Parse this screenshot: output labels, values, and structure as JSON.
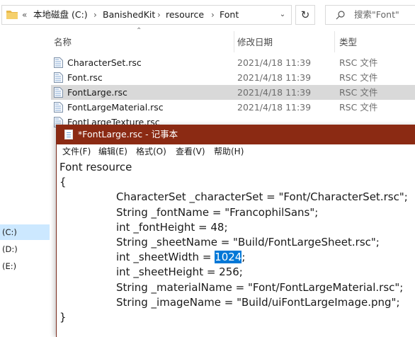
{
  "explorer": {
    "address": {
      "overflow": "«",
      "crumbs": [
        "本地磁盘 (C:)",
        "BanishedKit",
        "resource",
        "Font"
      ],
      "separator": "›"
    },
    "search_placeholder": "搜索\"Font\"",
    "columns": {
      "name": "名称",
      "date": "修改日期",
      "type": "类型"
    },
    "files": [
      {
        "name": "CharacterSet.rsc",
        "date": "2021/4/18 11:39",
        "type": "RSC 文件",
        "selected": false
      },
      {
        "name": "Font.rsc",
        "date": "2021/4/18 11:39",
        "type": "RSC 文件",
        "selected": false
      },
      {
        "name": "FontLarge.rsc",
        "date": "2021/4/18 11:39",
        "type": "RSC 文件",
        "selected": true
      },
      {
        "name": "FontLargeMaterial.rsc",
        "date": "2021/4/18 11:39",
        "type": "RSC 文件",
        "selected": false
      },
      {
        "name": "FontLargeTexture.rsc",
        "date": "",
        "type": "",
        "selected": false
      }
    ],
    "drives": [
      {
        "label": "(C:)",
        "selected": true
      },
      {
        "label": "(D:)",
        "selected": false
      },
      {
        "label": "(E:)",
        "selected": false
      }
    ]
  },
  "notepad": {
    "title": "*FontLarge.rsc - 记事本",
    "menu": [
      "文件(F)",
      "编辑(E)",
      "格式(O)",
      "查看(V)",
      "帮助(H)"
    ],
    "lines": [
      {
        "indent": false,
        "text": "Font resource"
      },
      {
        "indent": false,
        "text": "{"
      },
      {
        "indent": true,
        "text": "CharacterSet _characterSet = \"Font/CharacterSet.rsc\";"
      },
      {
        "indent": true,
        "text": "String _fontName = \"FrancophilSans\";"
      },
      {
        "indent": true,
        "text": "int _fontHeight = 48;"
      },
      {
        "indent": true,
        "text": "String _sheetName = \"Build/FontLargeSheet.rsc\";"
      },
      {
        "indent": true,
        "pre": "int _sheetWidth = ",
        "selected": "1024",
        "post": ";"
      },
      {
        "indent": true,
        "text": "int _sheetHeight = 256;"
      },
      {
        "indent": true,
        "text": "String _materialName = \"Font/FontLargeMaterial.rsc\";"
      },
      {
        "indent": true,
        "text": "String _imageName = \"Build/uiFontLargeImage.png\";"
      },
      {
        "indent": false,
        "text": "}"
      }
    ],
    "colors": {
      "titlebar": "#8b2a13",
      "selection": "#0078d7"
    }
  }
}
